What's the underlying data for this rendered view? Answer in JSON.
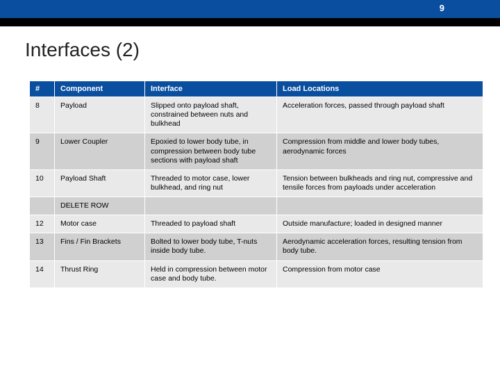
{
  "slide_number": "9",
  "title": "Interfaces (2)",
  "headers": {
    "num": "#",
    "component": "Component",
    "interface": "Interface",
    "load": "Load Locations"
  },
  "rows": [
    {
      "num": "8",
      "component": "Payload",
      "interface": "Slipped onto payload shaft, constrained between nuts and bulkhead",
      "load": "Acceleration forces, passed through payload shaft"
    },
    {
      "num": "9",
      "component": "Lower Coupler",
      "interface": "Epoxied to lower body tube, in compression between body tube sections with payload shaft",
      "load": "Compression from middle and lower body tubes, aerodynamic forces"
    },
    {
      "num": "10",
      "component": "Payload Shaft",
      "interface": "Threaded to motor case, lower bulkhead, and ring nut",
      "load": "Tension between bulkheads and ring nut, compressive and tensile forces from payloads under acceleration"
    },
    {
      "num": "",
      "component": "DELETE ROW",
      "interface": "",
      "load": ""
    },
    {
      "num": "12",
      "component": "Motor case",
      "interface": "Threaded to payload shaft",
      "load": "Outside manufacture; loaded in designed manner"
    },
    {
      "num": "13",
      "component": "Fins / Fin Brackets",
      "interface": "Bolted to lower body tube, T-nuts inside body tube.",
      "load": "Aerodynamic acceleration forces, resulting tension from body tube."
    },
    {
      "num": "14",
      "component": "Thrust Ring",
      "interface": "Held in compression between motor case and body tube.",
      "load": "Compression from motor case"
    }
  ]
}
